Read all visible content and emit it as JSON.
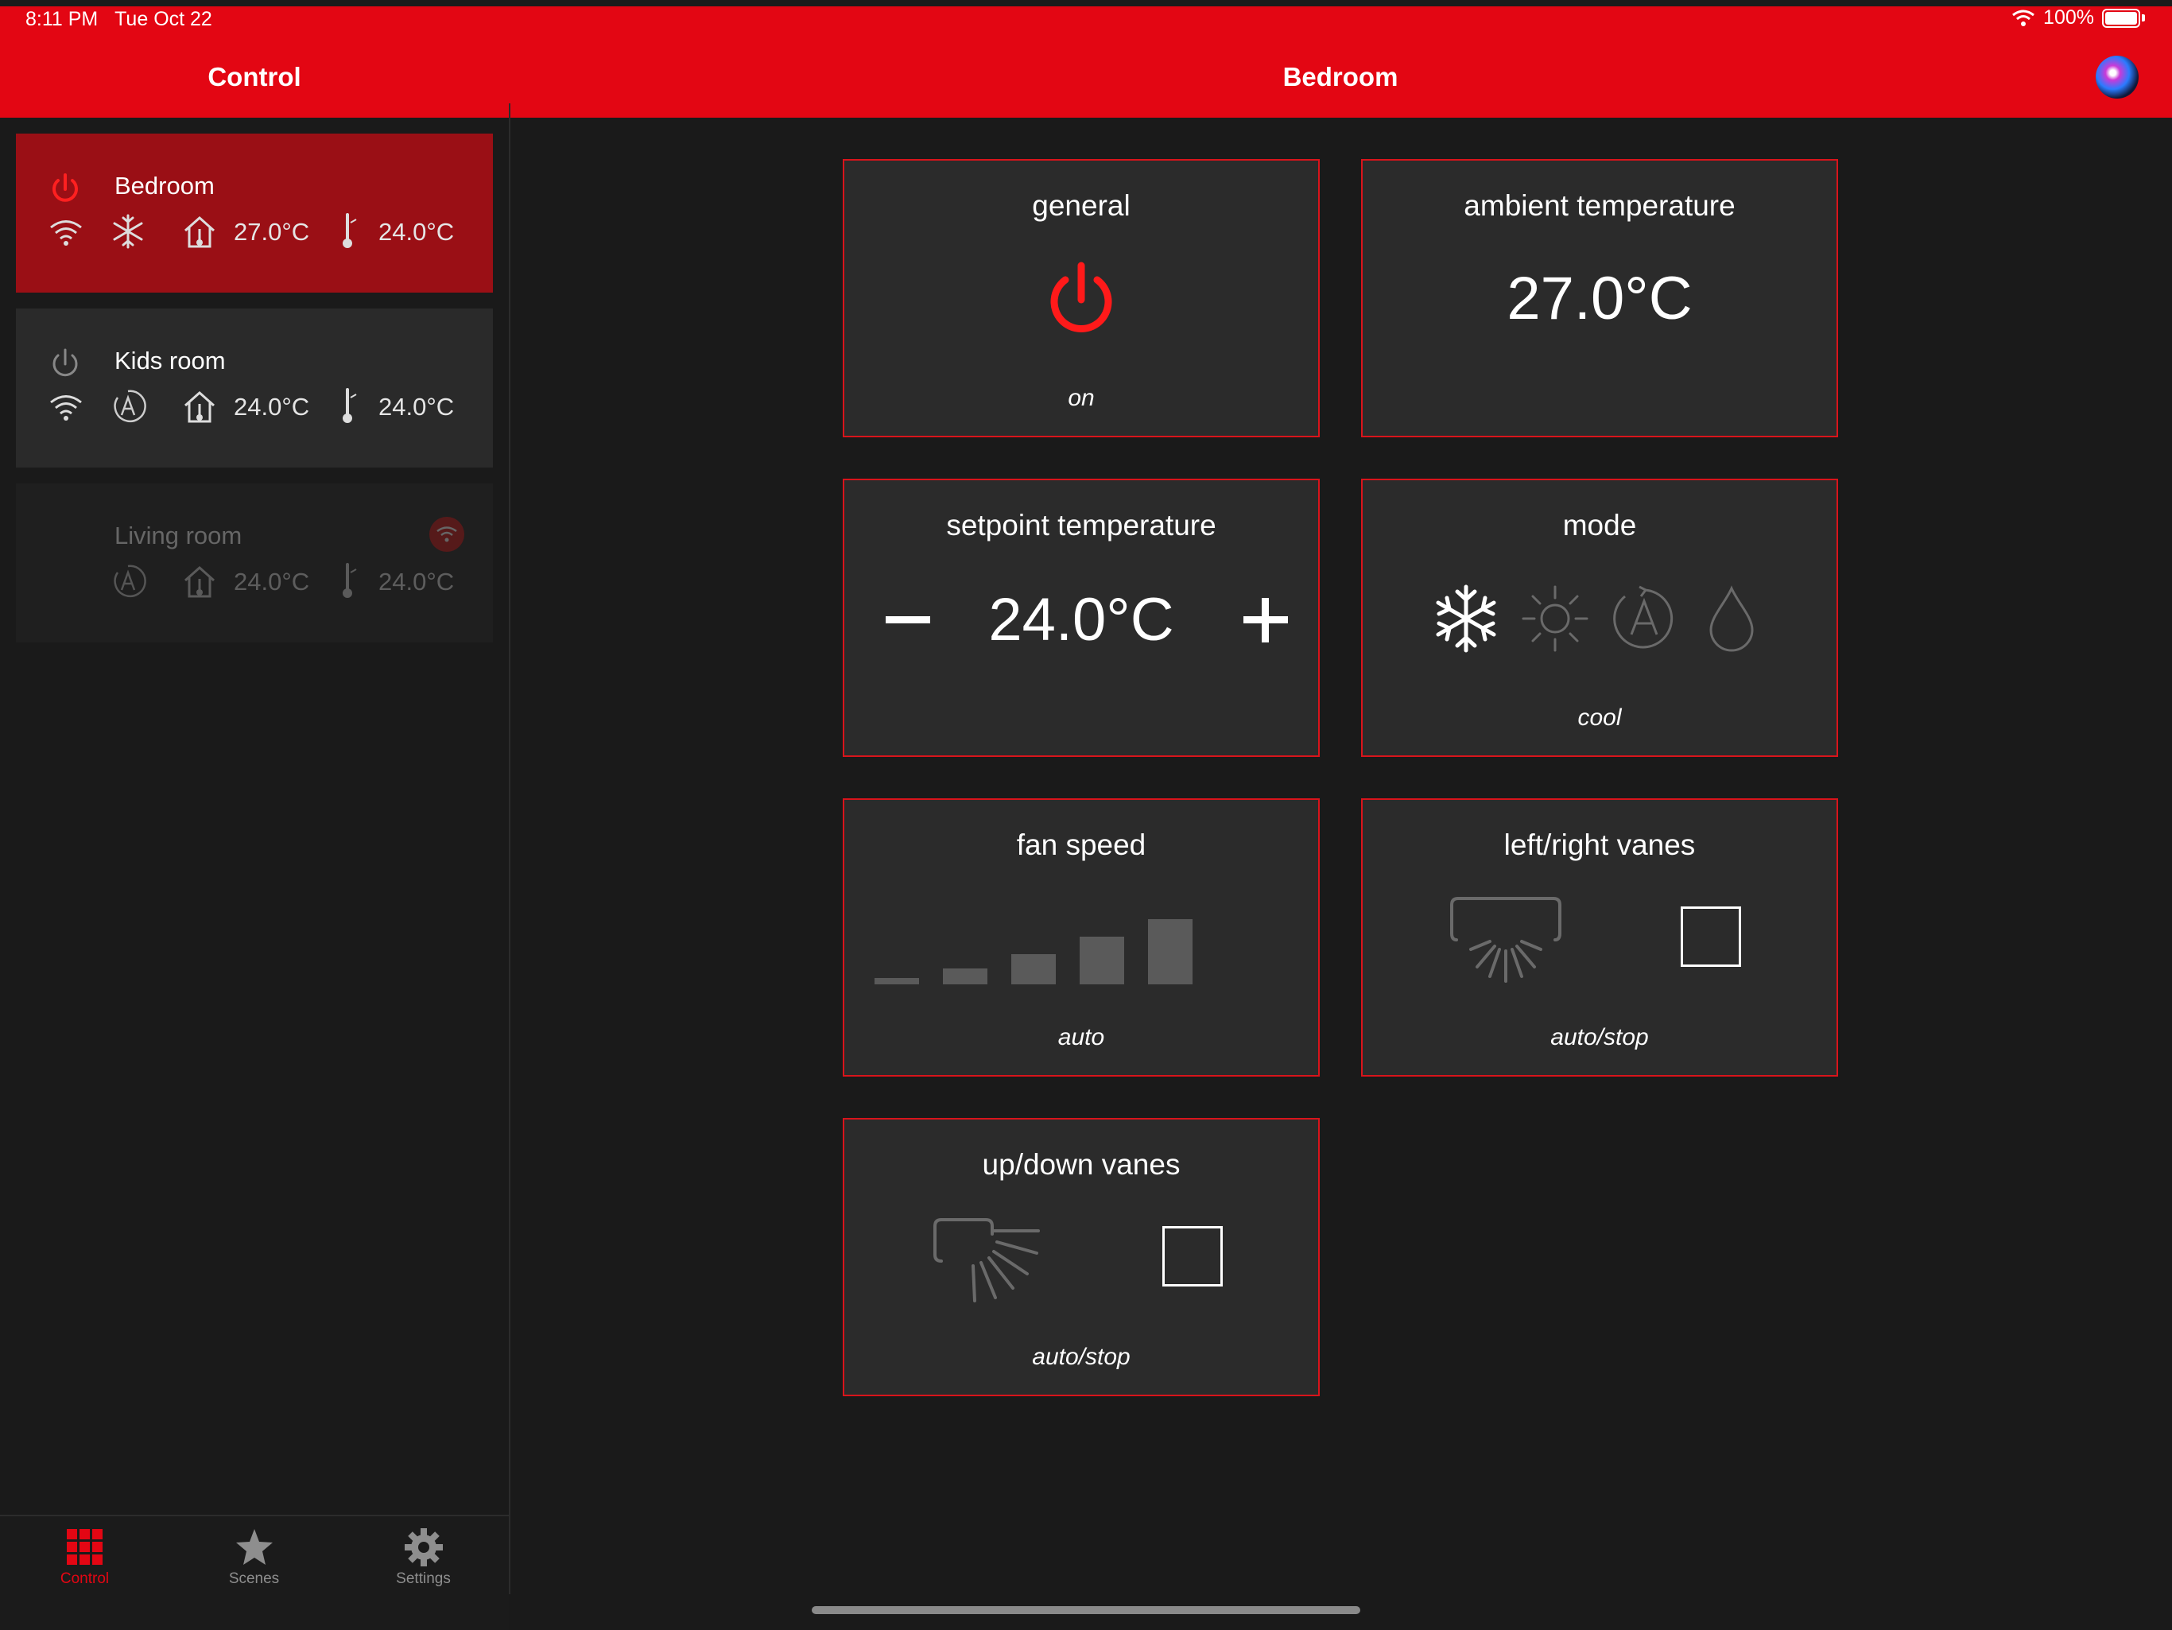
{
  "status_bar": {
    "time": "8:11 PM",
    "date": "Tue Oct 22",
    "battery": "100%"
  },
  "nav": {
    "left_title": "Control",
    "title": "Bedroom"
  },
  "rooms": [
    {
      "name": "Bedroom",
      "power": "on",
      "mode_icon": "snowflake-icon",
      "ambient": "27.0°C",
      "setpoint": "24.0°C"
    },
    {
      "name": "Kids room",
      "power": "off",
      "mode_icon": "auto-mode-icon",
      "ambient": "24.0°C",
      "setpoint": "24.0°C"
    },
    {
      "name": "Living room",
      "power": "offline",
      "mode_icon": "auto-mode-icon",
      "ambient": "24.0°C",
      "setpoint": "24.0°C"
    }
  ],
  "tabs": [
    {
      "label": "Control",
      "icon": "grid-icon",
      "active": true
    },
    {
      "label": "Scenes",
      "icon": "star-icon",
      "active": false
    },
    {
      "label": "Settings",
      "icon": "gear-icon",
      "active": false
    }
  ],
  "cards": {
    "general": {
      "title": "general",
      "caption": "on"
    },
    "ambient": {
      "title": "ambient temperature",
      "value": "27.0°C"
    },
    "setpoint": {
      "title": "setpoint temperature",
      "value": "24.0°C"
    },
    "mode": {
      "title": "mode",
      "caption": "cool",
      "options": [
        "cool",
        "heat",
        "auto",
        "dry"
      ],
      "selected": "cool"
    },
    "fan": {
      "title": "fan speed",
      "caption": "auto",
      "levels": 5
    },
    "lr_vanes": {
      "title": "left/right vanes",
      "caption": "auto/stop"
    },
    "ud_vanes": {
      "title": "up/down vanes",
      "caption": "auto/stop"
    }
  },
  "colors": {
    "accent": "#e30613",
    "card_border": "#d9141b",
    "card_bg": "#2b2b2b",
    "background": "#1a1a1a",
    "active_room": "#9a0f15"
  }
}
